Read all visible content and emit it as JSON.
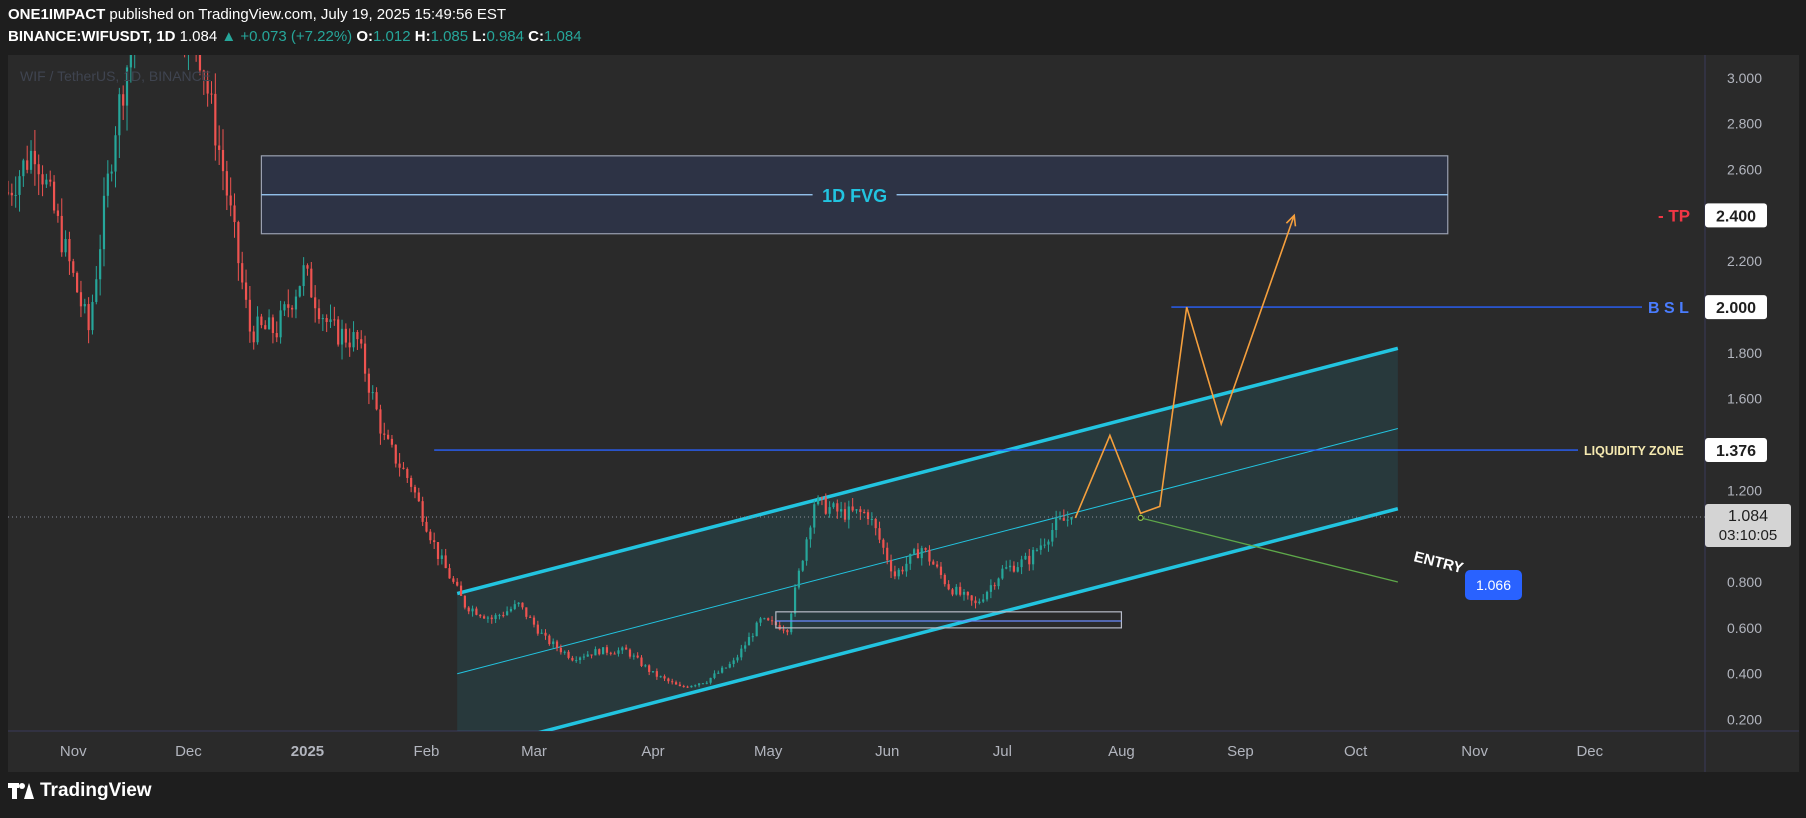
{
  "header": {
    "publisher": "ONE1IMPACT",
    "published_text": "published on TradingView.com, July 19, 2025 15:49:56 EST",
    "symbol": "BINANCE:WIFUSDT, 1D",
    "last": "1.084",
    "change": "+0.073 (+7.22%)",
    "open_label": "O:",
    "open": "1.012",
    "high_label": "H:",
    "high": "1.085",
    "low_label": "L:",
    "low": "0.984",
    "close_label": "C:",
    "close": "1.084"
  },
  "watermark": "WIF / TetherUS, 1D, BINANCE",
  "footer": {
    "brand": "TradingView"
  },
  "chart_data": {
    "type": "candlestick",
    "y_axis": {
      "min": 0.15,
      "max": 3.1,
      "side": "right",
      "ticks": [
        "0.200",
        "0.400",
        "0.600",
        "0.800",
        "1.200",
        "1.600",
        "1.800",
        "2.200",
        "2.600",
        "2.800",
        "3.000"
      ]
    },
    "x_axis": {
      "start": "2024-10-15",
      "end": "2025-12-31",
      "labels": [
        {
          "text": "Nov",
          "date": "2024-11-01"
        },
        {
          "text": "Dec",
          "date": "2024-12-01"
        },
        {
          "text": "2025",
          "date": "2025-01-01"
        },
        {
          "text": "Feb",
          "date": "2025-02-01"
        },
        {
          "text": "Mar",
          "date": "2025-03-01"
        },
        {
          "text": "Apr",
          "date": "2025-04-01"
        },
        {
          "text": "May",
          "date": "2025-05-01"
        },
        {
          "text": "Jun",
          "date": "2025-06-01"
        },
        {
          "text": "Jul",
          "date": "2025-07-01"
        },
        {
          "text": "Aug",
          "date": "2025-08-01"
        },
        {
          "text": "Sep",
          "date": "2025-09-01"
        },
        {
          "text": "Oct",
          "date": "2025-10-01"
        },
        {
          "text": "Nov",
          "date": "2025-11-01"
        },
        {
          "text": "Dec",
          "date": "2025-12-01"
        }
      ]
    },
    "price_path": [
      [
        "2024-10-15",
        2.5
      ],
      [
        "2024-10-22",
        2.7
      ],
      [
        "2024-10-29",
        2.3
      ],
      [
        "2024-11-05",
        1.9
      ],
      [
        "2024-11-12",
        2.8
      ],
      [
        "2024-11-19",
        3.4
      ],
      [
        "2024-11-26",
        3.3
      ],
      [
        "2024-12-03",
        3.2
      ],
      [
        "2024-12-10",
        2.6
      ],
      [
        "2024-12-17",
        1.9
      ],
      [
        "2024-12-24",
        1.9
      ],
      [
        "2024-12-31",
        2.15
      ],
      [
        "2025-01-07",
        1.9
      ],
      [
        "2025-01-14",
        1.85
      ],
      [
        "2025-01-21",
        1.42
      ],
      [
        "2025-01-28",
        1.23
      ],
      [
        "2025-02-04",
        0.92
      ],
      [
        "2025-02-11",
        0.7
      ],
      [
        "2025-02-18",
        0.64
      ],
      [
        "2025-02-25",
        0.7
      ],
      [
        "2025-03-04",
        0.55
      ],
      [
        "2025-03-11",
        0.47
      ],
      [
        "2025-03-18",
        0.5
      ],
      [
        "2025-03-25",
        0.5
      ],
      [
        "2025-04-01",
        0.4
      ],
      [
        "2025-04-08",
        0.34
      ],
      [
        "2025-04-15",
        0.37
      ],
      [
        "2025-04-22",
        0.45
      ],
      [
        "2025-04-29",
        0.63
      ],
      [
        "2025-05-06",
        0.6
      ],
      [
        "2025-05-13",
        1.15
      ],
      [
        "2025-05-20",
        1.1
      ],
      [
        "2025-05-27",
        1.1
      ],
      [
        "2025-06-03",
        0.83
      ],
      [
        "2025-06-10",
        0.95
      ],
      [
        "2025-06-17",
        0.78
      ],
      [
        "2025-06-24",
        0.7
      ],
      [
        "2025-07-01",
        0.85
      ],
      [
        "2025-07-08",
        0.9
      ],
      [
        "2025-07-15",
        1.05
      ],
      [
        "2025-07-19",
        1.084
      ]
    ],
    "last_price": {
      "value": 1.084,
      "label": "1.084",
      "countdown": "03:10:05"
    },
    "levels": [
      {
        "name": "TP",
        "label": "TP",
        "value": 2.4,
        "value_label": "2.400",
        "color": "#f23645"
      },
      {
        "name": "BSL",
        "label": "B S L",
        "value": 2.0,
        "value_label": "2.000",
        "color": "#2962ff"
      },
      {
        "name": "Liquidity Zone",
        "label": "LIQUIDITY ZONE",
        "value": 1.376,
        "value_label": "1.376",
        "color": "#2962ff"
      }
    ],
    "fvg_zone": {
      "label": "1D FVG",
      "top": 2.66,
      "bottom": 2.32,
      "mid": 2.49,
      "from": "2024-12-20",
      "to": "2025-10-25"
    },
    "channel": {
      "upper": [
        [
          "2025-02-09",
          0.75
        ],
        [
          "2025-10-12",
          1.82
        ]
      ],
      "lower": [
        [
          "2025-02-09",
          0.05
        ],
        [
          "2025-10-12",
          1.12
        ]
      ],
      "mid": [
        [
          "2025-02-09",
          0.4
        ],
        [
          "2025-10-12",
          1.47
        ]
      ]
    },
    "order_block": {
      "top": 0.67,
      "bottom": 0.6,
      "mid": 0.63,
      "from": "2025-05-03",
      "to": "2025-08-01"
    },
    "projection": [
      [
        "2025-07-20",
        1.08
      ],
      [
        "2025-07-29",
        1.44
      ],
      [
        "2025-08-06",
        1.1
      ],
      [
        "2025-08-11",
        1.13
      ],
      [
        "2025-08-18",
        2.0
      ],
      [
        "2025-08-27",
        1.49
      ],
      [
        "2025-09-15",
        2.4
      ]
    ],
    "entry": {
      "label": "ENTRY",
      "value": 1.066,
      "value_label": "1.066",
      "from": [
        "2025-08-06",
        1.08
      ],
      "to": [
        "2025-10-12",
        0.8
      ]
    },
    "colors": {
      "up": "#26a69a",
      "down": "#ef5350",
      "channel": "#22c4e0",
      "level": "#2962ff",
      "projection": "#f59f3d",
      "entry": "#5ea84a",
      "fvg_fill": "#2e3448",
      "entry_badge": "#2962ff"
    }
  }
}
